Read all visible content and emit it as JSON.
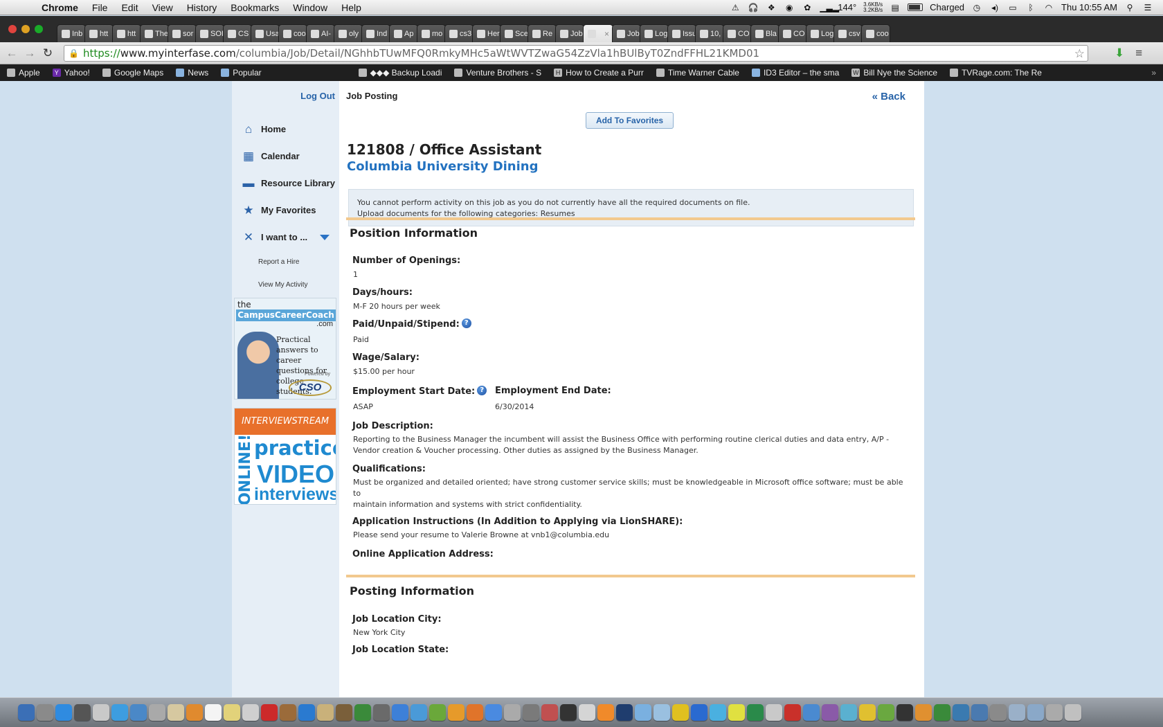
{
  "menubar": {
    "app": "Chrome",
    "items": [
      "File",
      "Edit",
      "View",
      "History",
      "Bookmarks",
      "Window",
      "Help"
    ],
    "status": {
      "temp": "144°",
      "net_up": "3.6KB/s",
      "net_down": "3.2KB/s",
      "battery": "Charged",
      "clock": "Thu 10:55 AM"
    }
  },
  "tabs": [
    {
      "label": "Inb"
    },
    {
      "label": "htt"
    },
    {
      "label": "htt"
    },
    {
      "label": "The"
    },
    {
      "label": "sor"
    },
    {
      "label": "SOI"
    },
    {
      "label": "CS"
    },
    {
      "label": "Usa"
    },
    {
      "label": "coo"
    },
    {
      "label": "AI-"
    },
    {
      "label": "oly"
    },
    {
      "label": "Ind"
    },
    {
      "label": "Ap"
    },
    {
      "label": "mo"
    },
    {
      "label": "cs3"
    },
    {
      "label": "Her"
    },
    {
      "label": "Sce"
    },
    {
      "label": "Re"
    },
    {
      "label": "Job"
    },
    {
      "label": ""
    },
    {
      "label": "Job"
    },
    {
      "label": "Log"
    },
    {
      "label": "Issu"
    },
    {
      "label": "10,"
    },
    {
      "label": "CO"
    },
    {
      "label": "Bla"
    },
    {
      "label": "CO"
    },
    {
      "label": "Log"
    },
    {
      "label": "csv"
    },
    {
      "label": "coo"
    }
  ],
  "active_tab_index": 19,
  "address": {
    "scheme": "https://",
    "host": "www.myinterfase.com",
    "path": "/columbia/Job/Detail/NGhhbTUwMFQ0RmkyMHc5aWtWVTZwaG54ZzVla1hBUlByT0ZndFFHL21KMD01"
  },
  "bookmarks": [
    {
      "label": "Apple"
    },
    {
      "label": "Yahoo!"
    },
    {
      "label": "Google Maps"
    },
    {
      "label": "News"
    },
    {
      "label": "Popular"
    },
    {
      "label": "◆◆◆ Backup Loadi"
    },
    {
      "label": "Venture Brothers - S"
    },
    {
      "label": "How to Create a Purr"
    },
    {
      "label": "Time Warner Cable"
    },
    {
      "label": "ID3 Editor – the sma"
    },
    {
      "label": "Bill Nye the Science"
    },
    {
      "label": "TVRage.com: The Re"
    }
  ],
  "sidebar": {
    "logout": "Log Out",
    "nav": [
      {
        "label": "Home",
        "icon": "home-icon"
      },
      {
        "label": "Calendar",
        "icon": "calendar-icon"
      },
      {
        "label": "Resource Library",
        "icon": "folder-icon"
      },
      {
        "label": "My Favorites",
        "icon": "star-icon"
      },
      {
        "label": "I want to ...",
        "icon": "tools-icon"
      }
    ],
    "sub_items": [
      "Report a Hire",
      "View My Activity"
    ],
    "ad1": {
      "the": "the",
      "brand": "CampusCareerCoach",
      "dotcom": ".com",
      "tagline": "Practical answers to career questions for college students.",
      "powered": "Powered by",
      "logo": "CSO"
    },
    "ad2": {
      "top": "INTERVIEWSTREAM",
      "online": "ONLINE!",
      "practice": "practice",
      "video": "VIDEO",
      "interviews": "interviews"
    }
  },
  "main": {
    "crumb": "Job Posting",
    "back": "« Back",
    "favorites_button": "Add To Favorites",
    "job_title": "121808 / Office Assistant",
    "employer": "Columbia University Dining",
    "alert_line1": "You cannot perform activity on this job as you do not currently have all the required documents on file.",
    "alert_line2": "Upload documents for the following categories: Resumes",
    "position_section": "Position Information",
    "fields": {
      "openings_label": "Number of Openings:",
      "openings": "1",
      "hours_label": "Days/hours:",
      "hours": "M-F 20 hours per week",
      "paid_label": "Paid/Unpaid/Stipend:",
      "paid": "Paid",
      "wage_label": "Wage/Salary:",
      "wage": "$15.00 per hour",
      "start_label": "Employment Start Date:",
      "start": "ASAP",
      "end_label": "Employment End Date:",
      "end": "6/30/2014",
      "desc_label": "Job Description:",
      "desc": "Reporting to the Business Manager the incumbent will assist the Business Office with performing routine clerical duties and data entry, A/P - Vendor creation & Voucher processing. Other duties as assigned by the Business Manager.",
      "qual_label": "Qualifications:",
      "qual_line1": "Must be organized and detailed oriented; have strong customer service skills; must be knowledgeable in Microsoft office software; must be able to",
      "qual_line2": "maintain information and systems with strict confidentiality.",
      "instr_label": "Application Instructions (In Addition to Applying via LionSHARE):",
      "instr": "Please send your resume to Valerie Browne at vnb1@columbia.edu",
      "online_label": "Online Application Address:"
    },
    "posting_section": "Posting Information",
    "posting": {
      "city_label": "Job Location City:",
      "city": "New York City",
      "state_label": "Job Location State:"
    }
  },
  "colors": {
    "link": "#2763a8",
    "divider": "#f2c98e",
    "page_bg": "#cfe0ef"
  }
}
